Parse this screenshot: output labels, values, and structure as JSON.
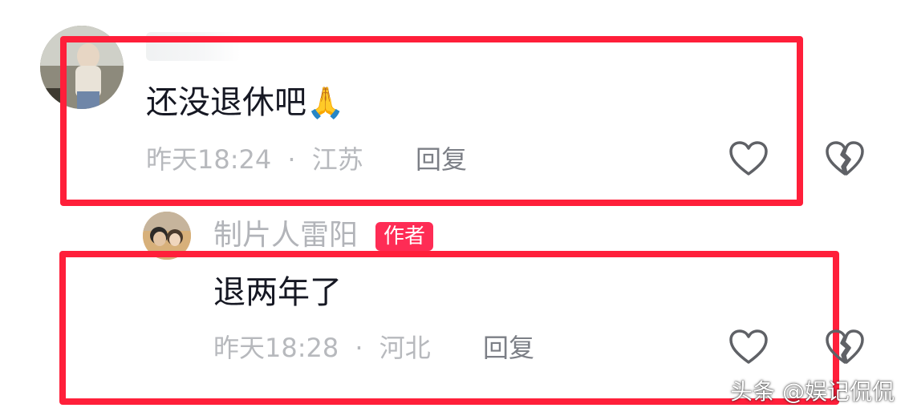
{
  "comment1": {
    "avatar_icon": "user-avatar",
    "text": "还没退休吧",
    "emoji": "🙏",
    "time": "昨天18:24",
    "separator": "·",
    "location": "江苏",
    "reply_label": "回复"
  },
  "reply1": {
    "avatar_icon": "user-avatar",
    "username": "制片人雷阳",
    "author_badge": "作者",
    "text": "退两年了",
    "time": "昨天18:28",
    "separator": "·",
    "location": "河北",
    "reply_label": "回复"
  },
  "icons": {
    "like": "heart-outline-icon",
    "dislike": "broken-heart-icon"
  },
  "colors": {
    "highlight_box": "#ff1f3a",
    "author_badge": "#fe2c55",
    "meta_text": "#b7b9bd",
    "body_text": "#161823"
  },
  "watermark": "头条 @娱记侃侃"
}
